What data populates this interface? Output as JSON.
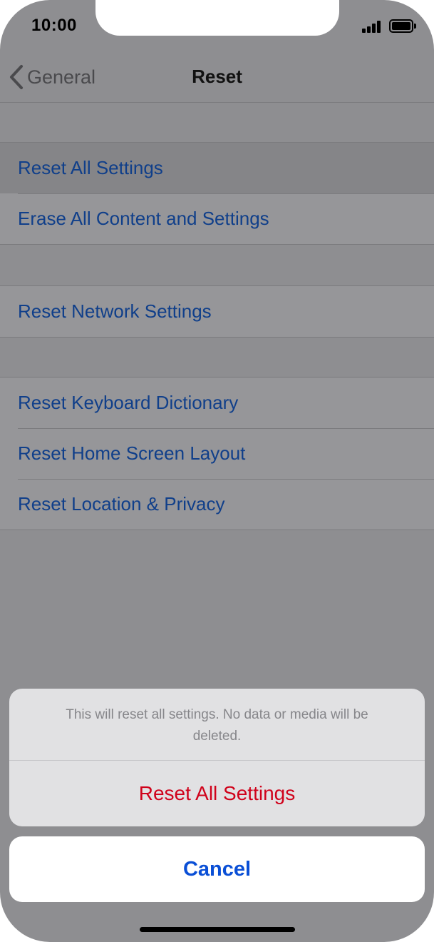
{
  "status_bar": {
    "time": "10:00",
    "signal_icon": "cellular-signal-icon",
    "battery_icon": "battery-full-icon"
  },
  "nav": {
    "back_icon": "chevron-left-icon",
    "back_label": "General",
    "title": "Reset"
  },
  "groups": [
    {
      "items": [
        {
          "label": "Reset All Settings"
        },
        {
          "label": "Erase All Content and Settings"
        }
      ]
    },
    {
      "items": [
        {
          "label": "Reset Network Settings"
        }
      ]
    },
    {
      "items": [
        {
          "label": "Reset Keyboard Dictionary"
        },
        {
          "label": "Reset Home Screen Layout"
        },
        {
          "label": "Reset Location & Privacy"
        }
      ]
    }
  ],
  "action_sheet": {
    "message": "This will reset all settings. No data or media will be deleted.",
    "destructive_label": "Reset All Settings",
    "cancel_label": "Cancel"
  },
  "colors": {
    "row_text": "#103f8a",
    "destructive": "#d0021b",
    "cancel": "#0a4fd6"
  }
}
